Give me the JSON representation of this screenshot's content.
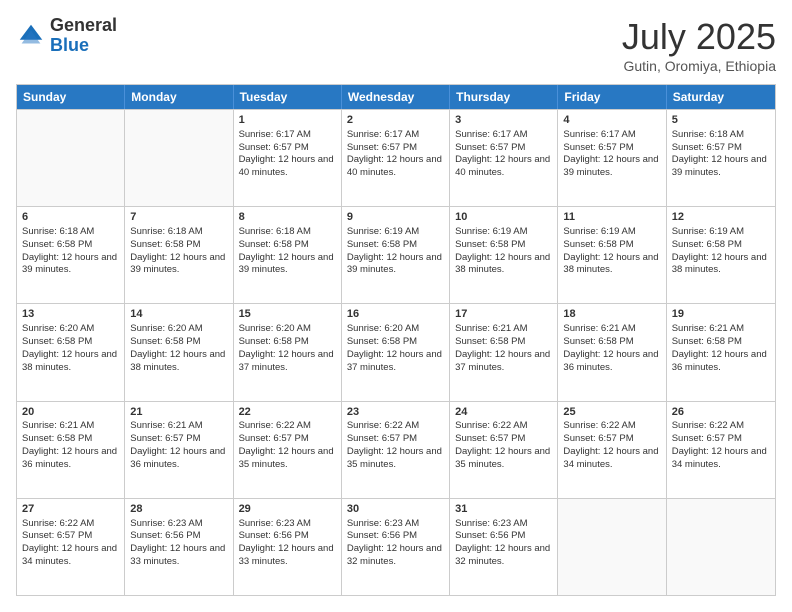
{
  "header": {
    "logo_general": "General",
    "logo_blue": "Blue",
    "month_title": "July 2025",
    "location": "Gutin, Oromiya, Ethiopia"
  },
  "days_of_week": [
    "Sunday",
    "Monday",
    "Tuesday",
    "Wednesday",
    "Thursday",
    "Friday",
    "Saturday"
  ],
  "weeks": [
    [
      {
        "day": "",
        "info": ""
      },
      {
        "day": "",
        "info": ""
      },
      {
        "day": "1",
        "info": "Sunrise: 6:17 AM\nSunset: 6:57 PM\nDaylight: 12 hours and 40 minutes."
      },
      {
        "day": "2",
        "info": "Sunrise: 6:17 AM\nSunset: 6:57 PM\nDaylight: 12 hours and 40 minutes."
      },
      {
        "day": "3",
        "info": "Sunrise: 6:17 AM\nSunset: 6:57 PM\nDaylight: 12 hours and 40 minutes."
      },
      {
        "day": "4",
        "info": "Sunrise: 6:17 AM\nSunset: 6:57 PM\nDaylight: 12 hours and 39 minutes."
      },
      {
        "day": "5",
        "info": "Sunrise: 6:18 AM\nSunset: 6:57 PM\nDaylight: 12 hours and 39 minutes."
      }
    ],
    [
      {
        "day": "6",
        "info": "Sunrise: 6:18 AM\nSunset: 6:58 PM\nDaylight: 12 hours and 39 minutes."
      },
      {
        "day": "7",
        "info": "Sunrise: 6:18 AM\nSunset: 6:58 PM\nDaylight: 12 hours and 39 minutes."
      },
      {
        "day": "8",
        "info": "Sunrise: 6:18 AM\nSunset: 6:58 PM\nDaylight: 12 hours and 39 minutes."
      },
      {
        "day": "9",
        "info": "Sunrise: 6:19 AM\nSunset: 6:58 PM\nDaylight: 12 hours and 39 minutes."
      },
      {
        "day": "10",
        "info": "Sunrise: 6:19 AM\nSunset: 6:58 PM\nDaylight: 12 hours and 38 minutes."
      },
      {
        "day": "11",
        "info": "Sunrise: 6:19 AM\nSunset: 6:58 PM\nDaylight: 12 hours and 38 minutes."
      },
      {
        "day": "12",
        "info": "Sunrise: 6:19 AM\nSunset: 6:58 PM\nDaylight: 12 hours and 38 minutes."
      }
    ],
    [
      {
        "day": "13",
        "info": "Sunrise: 6:20 AM\nSunset: 6:58 PM\nDaylight: 12 hours and 38 minutes."
      },
      {
        "day": "14",
        "info": "Sunrise: 6:20 AM\nSunset: 6:58 PM\nDaylight: 12 hours and 38 minutes."
      },
      {
        "day": "15",
        "info": "Sunrise: 6:20 AM\nSunset: 6:58 PM\nDaylight: 12 hours and 37 minutes."
      },
      {
        "day": "16",
        "info": "Sunrise: 6:20 AM\nSunset: 6:58 PM\nDaylight: 12 hours and 37 minutes."
      },
      {
        "day": "17",
        "info": "Sunrise: 6:21 AM\nSunset: 6:58 PM\nDaylight: 12 hours and 37 minutes."
      },
      {
        "day": "18",
        "info": "Sunrise: 6:21 AM\nSunset: 6:58 PM\nDaylight: 12 hours and 36 minutes."
      },
      {
        "day": "19",
        "info": "Sunrise: 6:21 AM\nSunset: 6:58 PM\nDaylight: 12 hours and 36 minutes."
      }
    ],
    [
      {
        "day": "20",
        "info": "Sunrise: 6:21 AM\nSunset: 6:58 PM\nDaylight: 12 hours and 36 minutes."
      },
      {
        "day": "21",
        "info": "Sunrise: 6:21 AM\nSunset: 6:57 PM\nDaylight: 12 hours and 36 minutes."
      },
      {
        "day": "22",
        "info": "Sunrise: 6:22 AM\nSunset: 6:57 PM\nDaylight: 12 hours and 35 minutes."
      },
      {
        "day": "23",
        "info": "Sunrise: 6:22 AM\nSunset: 6:57 PM\nDaylight: 12 hours and 35 minutes."
      },
      {
        "day": "24",
        "info": "Sunrise: 6:22 AM\nSunset: 6:57 PM\nDaylight: 12 hours and 35 minutes."
      },
      {
        "day": "25",
        "info": "Sunrise: 6:22 AM\nSunset: 6:57 PM\nDaylight: 12 hours and 34 minutes."
      },
      {
        "day": "26",
        "info": "Sunrise: 6:22 AM\nSunset: 6:57 PM\nDaylight: 12 hours and 34 minutes."
      }
    ],
    [
      {
        "day": "27",
        "info": "Sunrise: 6:22 AM\nSunset: 6:57 PM\nDaylight: 12 hours and 34 minutes."
      },
      {
        "day": "28",
        "info": "Sunrise: 6:23 AM\nSunset: 6:56 PM\nDaylight: 12 hours and 33 minutes."
      },
      {
        "day": "29",
        "info": "Sunrise: 6:23 AM\nSunset: 6:56 PM\nDaylight: 12 hours and 33 minutes."
      },
      {
        "day": "30",
        "info": "Sunrise: 6:23 AM\nSunset: 6:56 PM\nDaylight: 12 hours and 32 minutes."
      },
      {
        "day": "31",
        "info": "Sunrise: 6:23 AM\nSunset: 6:56 PM\nDaylight: 12 hours and 32 minutes."
      },
      {
        "day": "",
        "info": ""
      },
      {
        "day": "",
        "info": ""
      }
    ]
  ]
}
